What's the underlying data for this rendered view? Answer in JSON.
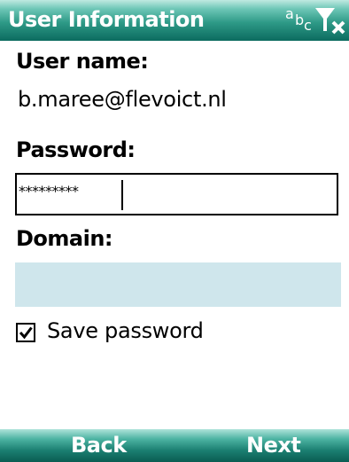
{
  "title_bar": {
    "title": "User Information",
    "input_mode": {
      "a": "a",
      "b": "b",
      "c": "c"
    },
    "icons": [
      "input-mode-icon",
      "no-signal-icon"
    ]
  },
  "form": {
    "username_label": "User name:",
    "username_value": "b.maree@flevoict.nl",
    "password_label": "Password:",
    "password_value": "*********",
    "domain_label": "Domain:",
    "domain_value": "",
    "save_password_label": "Save password",
    "save_password_checked": true
  },
  "softkeys": {
    "left": "Back",
    "right": "Next"
  },
  "colors": {
    "title_bar": "#2e9a87",
    "domain_field": "#cfe6ec",
    "text": "#000000"
  }
}
